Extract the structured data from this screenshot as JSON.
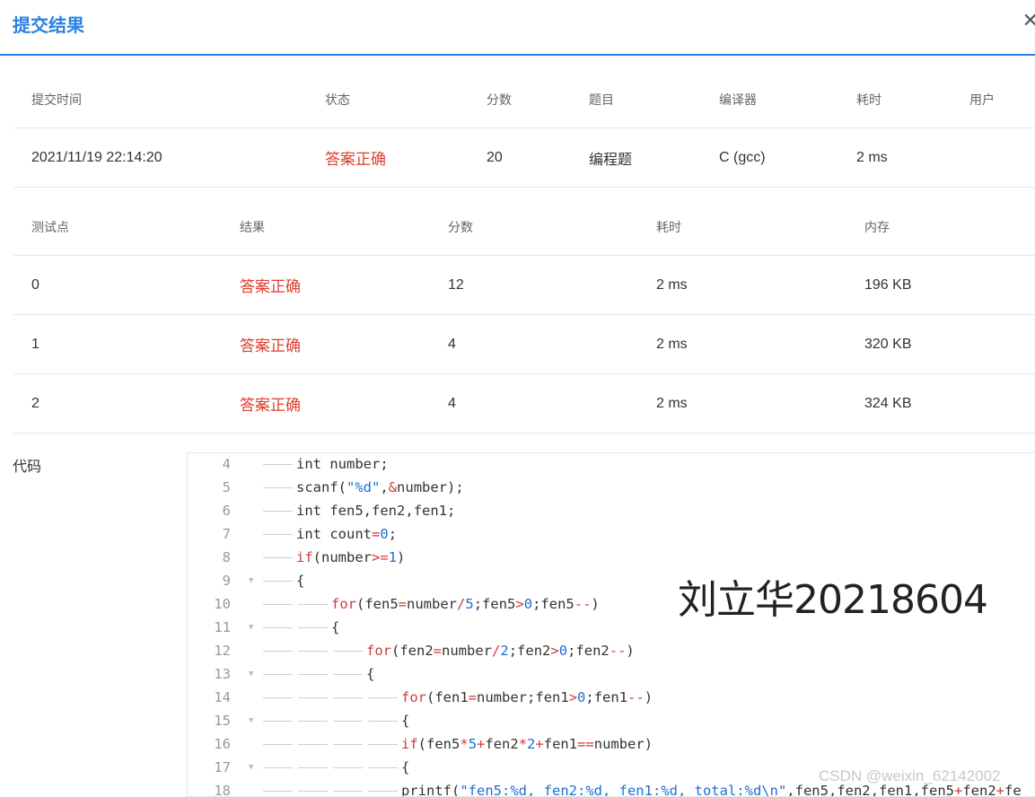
{
  "dialog": {
    "title": "提交结果",
    "close_icon": "close-icon"
  },
  "summary": {
    "headers": [
      "提交时间",
      "状态",
      "分数",
      "题目",
      "编译器",
      "耗时",
      "用户"
    ],
    "row": [
      "2021/11/19 22:14:20",
      "答案正确",
      "20",
      "编程题",
      "C (gcc)",
      "2 ms",
      ""
    ]
  },
  "tests": {
    "headers": [
      "测试点",
      "结果",
      "分数",
      "耗时",
      "内存"
    ],
    "rows": [
      [
        "0",
        "答案正确",
        "12",
        "2 ms",
        "196 KB"
      ],
      [
        "1",
        "答案正确",
        "4",
        "2 ms",
        "320 KB"
      ],
      [
        "2",
        "答案正确",
        "4",
        "2 ms",
        "324 KB"
      ]
    ]
  },
  "code": {
    "label": "代码",
    "lines": [
      {
        "n": "4",
        "text": "int number;"
      },
      {
        "n": "5",
        "text": "scanf(\"%d\",&number);"
      },
      {
        "n": "6",
        "text": "int fen5,fen2,fen1;"
      },
      {
        "n": "7",
        "text": "int count=0;"
      },
      {
        "n": "8",
        "text": "if(number>=1)"
      },
      {
        "n": "9",
        "text": "{"
      },
      {
        "n": "10",
        "text": "for(fen5=number/5;fen5>0;fen5--)"
      },
      {
        "n": "11",
        "text": "{"
      },
      {
        "n": "12",
        "text": "for(fen2=number/2;fen2>0;fen2--)"
      },
      {
        "n": "13",
        "text": "{"
      },
      {
        "n": "14",
        "text": "for(fen1=number;fen1>0;fen1--)"
      },
      {
        "n": "15",
        "text": "{"
      },
      {
        "n": "16",
        "text": "if(fen5*5+fen2*2+fen1==number)"
      },
      {
        "n": "17",
        "text": "{"
      },
      {
        "n": "18",
        "text": "printf(\"fen5:%d, fen2:%d, fen1:%d, total:%d\\n\",fen5,fen2,fen1,fen5+fen2+fe"
      }
    ]
  },
  "watermark": "刘立华20218604",
  "csdn_watermark": "CSDN @weixin_62142002",
  "colors": {
    "accent": "#2a82e4",
    "status_ok": "#e03e2d"
  }
}
